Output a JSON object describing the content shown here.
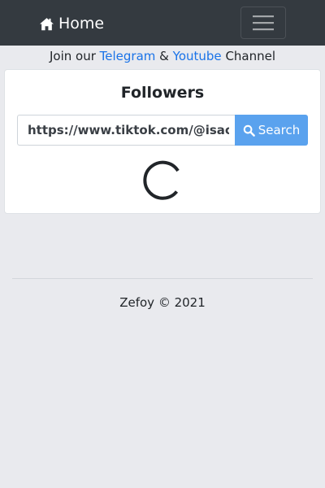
{
  "navbar": {
    "brand_label": "Home",
    "brand_icon": "home-icon",
    "toggler_icon": "menu-icon"
  },
  "channel_line": {
    "prefix": "Join our",
    "telegram_label": "Telegram",
    "amp": "&",
    "youtube_label": "Youtube",
    "suffix": "Channel"
  },
  "card": {
    "title": "Followers",
    "search_value": "https://www.tiktok.com/@isac",
    "search_button_label": "Search",
    "search_icon": "search-icon",
    "loading_icon": "loading-spinner-icon"
  },
  "footer": {
    "text": "Zefoy © 2021"
  },
  "colors": {
    "navbar_bg": "#343a40",
    "page_bg": "#e9eaee",
    "link": "#1a73e8",
    "button_bg": "#5aa2ee"
  }
}
